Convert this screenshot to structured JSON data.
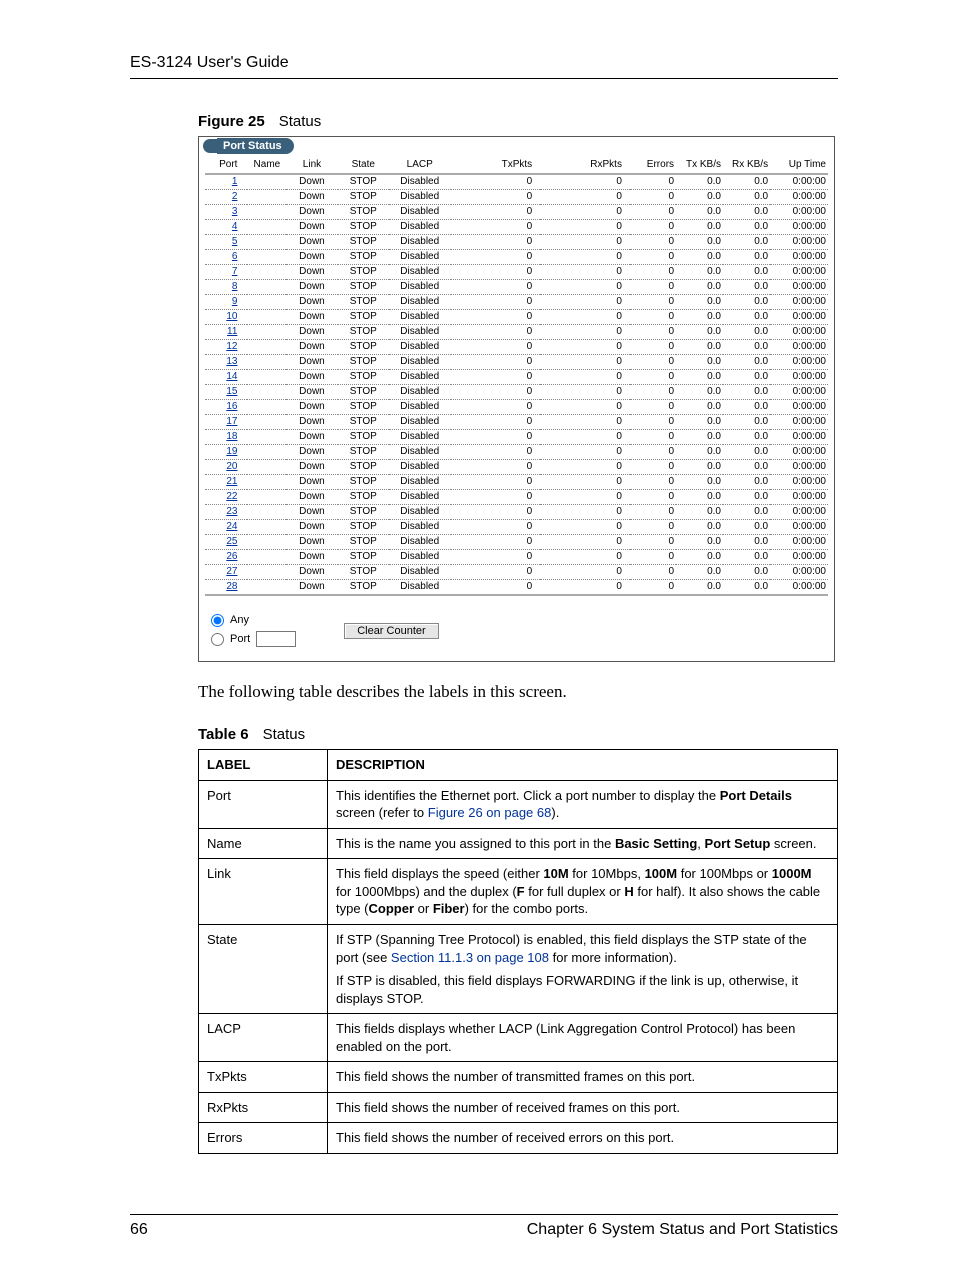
{
  "header": {
    "guide_title": "ES-3124 User's Guide"
  },
  "figure": {
    "label": "Figure 25",
    "title": "Status"
  },
  "panel": {
    "tab_title": "Port Status",
    "columns": {
      "port": "Port",
      "name": "Name",
      "link": "Link",
      "state": "State",
      "lacp": "LACP",
      "txpkts": "TxPkts",
      "rxpkts": "RxPkts",
      "errors": "Errors",
      "txkbs": "Tx KB/s",
      "rxkbs": "Rx KB/s",
      "uptime": "Up Time"
    },
    "rows": [
      {
        "port": "1",
        "name": "",
        "link": "Down",
        "state": "STOP",
        "lacp": "Disabled",
        "tx": "0",
        "rx": "0",
        "err": "0",
        "txk": "0.0",
        "rxk": "0.0",
        "ut": "0:00:00"
      },
      {
        "port": "2",
        "name": "",
        "link": "Down",
        "state": "STOP",
        "lacp": "Disabled",
        "tx": "0",
        "rx": "0",
        "err": "0",
        "txk": "0.0",
        "rxk": "0.0",
        "ut": "0:00:00"
      },
      {
        "port": "3",
        "name": "",
        "link": "Down",
        "state": "STOP",
        "lacp": "Disabled",
        "tx": "0",
        "rx": "0",
        "err": "0",
        "txk": "0.0",
        "rxk": "0.0",
        "ut": "0:00:00"
      },
      {
        "port": "4",
        "name": "",
        "link": "Down",
        "state": "STOP",
        "lacp": "Disabled",
        "tx": "0",
        "rx": "0",
        "err": "0",
        "txk": "0.0",
        "rxk": "0.0",
        "ut": "0:00:00"
      },
      {
        "port": "5",
        "name": "",
        "link": "Down",
        "state": "STOP",
        "lacp": "Disabled",
        "tx": "0",
        "rx": "0",
        "err": "0",
        "txk": "0.0",
        "rxk": "0.0",
        "ut": "0:00:00"
      },
      {
        "port": "6",
        "name": "",
        "link": "Down",
        "state": "STOP",
        "lacp": "Disabled",
        "tx": "0",
        "rx": "0",
        "err": "0",
        "txk": "0.0",
        "rxk": "0.0",
        "ut": "0:00:00"
      },
      {
        "port": "7",
        "name": "",
        "link": "Down",
        "state": "STOP",
        "lacp": "Disabled",
        "tx": "0",
        "rx": "0",
        "err": "0",
        "txk": "0.0",
        "rxk": "0.0",
        "ut": "0:00:00"
      },
      {
        "port": "8",
        "name": "",
        "link": "Down",
        "state": "STOP",
        "lacp": "Disabled",
        "tx": "0",
        "rx": "0",
        "err": "0",
        "txk": "0.0",
        "rxk": "0.0",
        "ut": "0:00:00"
      },
      {
        "port": "9",
        "name": "",
        "link": "Down",
        "state": "STOP",
        "lacp": "Disabled",
        "tx": "0",
        "rx": "0",
        "err": "0",
        "txk": "0.0",
        "rxk": "0.0",
        "ut": "0:00:00"
      },
      {
        "port": "10",
        "name": "",
        "link": "Down",
        "state": "STOP",
        "lacp": "Disabled",
        "tx": "0",
        "rx": "0",
        "err": "0",
        "txk": "0.0",
        "rxk": "0.0",
        "ut": "0:00:00"
      },
      {
        "port": "11",
        "name": "",
        "link": "Down",
        "state": "STOP",
        "lacp": "Disabled",
        "tx": "0",
        "rx": "0",
        "err": "0",
        "txk": "0.0",
        "rxk": "0.0",
        "ut": "0:00:00"
      },
      {
        "port": "12",
        "name": "",
        "link": "Down",
        "state": "STOP",
        "lacp": "Disabled",
        "tx": "0",
        "rx": "0",
        "err": "0",
        "txk": "0.0",
        "rxk": "0.0",
        "ut": "0:00:00"
      },
      {
        "port": "13",
        "name": "",
        "link": "Down",
        "state": "STOP",
        "lacp": "Disabled",
        "tx": "0",
        "rx": "0",
        "err": "0",
        "txk": "0.0",
        "rxk": "0.0",
        "ut": "0:00:00"
      },
      {
        "port": "14",
        "name": "",
        "link": "Down",
        "state": "STOP",
        "lacp": "Disabled",
        "tx": "0",
        "rx": "0",
        "err": "0",
        "txk": "0.0",
        "rxk": "0.0",
        "ut": "0:00:00"
      },
      {
        "port": "15",
        "name": "",
        "link": "Down",
        "state": "STOP",
        "lacp": "Disabled",
        "tx": "0",
        "rx": "0",
        "err": "0",
        "txk": "0.0",
        "rxk": "0.0",
        "ut": "0:00:00"
      },
      {
        "port": "16",
        "name": "",
        "link": "Down",
        "state": "STOP",
        "lacp": "Disabled",
        "tx": "0",
        "rx": "0",
        "err": "0",
        "txk": "0.0",
        "rxk": "0.0",
        "ut": "0:00:00"
      },
      {
        "port": "17",
        "name": "",
        "link": "Down",
        "state": "STOP",
        "lacp": "Disabled",
        "tx": "0",
        "rx": "0",
        "err": "0",
        "txk": "0.0",
        "rxk": "0.0",
        "ut": "0:00:00"
      },
      {
        "port": "18",
        "name": "",
        "link": "Down",
        "state": "STOP",
        "lacp": "Disabled",
        "tx": "0",
        "rx": "0",
        "err": "0",
        "txk": "0.0",
        "rxk": "0.0",
        "ut": "0:00:00"
      },
      {
        "port": "19",
        "name": "",
        "link": "Down",
        "state": "STOP",
        "lacp": "Disabled",
        "tx": "0",
        "rx": "0",
        "err": "0",
        "txk": "0.0",
        "rxk": "0.0",
        "ut": "0:00:00"
      },
      {
        "port": "20",
        "name": "",
        "link": "Down",
        "state": "STOP",
        "lacp": "Disabled",
        "tx": "0",
        "rx": "0",
        "err": "0",
        "txk": "0.0",
        "rxk": "0.0",
        "ut": "0:00:00"
      },
      {
        "port": "21",
        "name": "",
        "link": "Down",
        "state": "STOP",
        "lacp": "Disabled",
        "tx": "0",
        "rx": "0",
        "err": "0",
        "txk": "0.0",
        "rxk": "0.0",
        "ut": "0:00:00"
      },
      {
        "port": "22",
        "name": "",
        "link": "Down",
        "state": "STOP",
        "lacp": "Disabled",
        "tx": "0",
        "rx": "0",
        "err": "0",
        "txk": "0.0",
        "rxk": "0.0",
        "ut": "0:00:00"
      },
      {
        "port": "23",
        "name": "",
        "link": "Down",
        "state": "STOP",
        "lacp": "Disabled",
        "tx": "0",
        "rx": "0",
        "err": "0",
        "txk": "0.0",
        "rxk": "0.0",
        "ut": "0:00:00"
      },
      {
        "port": "24",
        "name": "",
        "link": "Down",
        "state": "STOP",
        "lacp": "Disabled",
        "tx": "0",
        "rx": "0",
        "err": "0",
        "txk": "0.0",
        "rxk": "0.0",
        "ut": "0:00:00"
      },
      {
        "port": "25",
        "name": "",
        "link": "Down",
        "state": "STOP",
        "lacp": "Disabled",
        "tx": "0",
        "rx": "0",
        "err": "0",
        "txk": "0.0",
        "rxk": "0.0",
        "ut": "0:00:00"
      },
      {
        "port": "26",
        "name": "",
        "link": "Down",
        "state": "STOP",
        "lacp": "Disabled",
        "tx": "0",
        "rx": "0",
        "err": "0",
        "txk": "0.0",
        "rxk": "0.0",
        "ut": "0:00:00"
      },
      {
        "port": "27",
        "name": "",
        "link": "Down",
        "state": "STOP",
        "lacp": "Disabled",
        "tx": "0",
        "rx": "0",
        "err": "0",
        "txk": "0.0",
        "rxk": "0.0",
        "ut": "0:00:00"
      },
      {
        "port": "28",
        "name": "",
        "link": "Down",
        "state": "STOP",
        "lacp": "Disabled",
        "tx": "0",
        "rx": "0",
        "err": "0",
        "txk": "0.0",
        "rxk": "0.0",
        "ut": "0:00:00"
      }
    ],
    "footer": {
      "any_label": "Any",
      "port_label": "Port",
      "clear_label": "Clear Counter",
      "port_value": ""
    }
  },
  "body_text": "The following table describes the labels in this screen.",
  "table_caption": {
    "label": "Table 6",
    "title": "Status"
  },
  "desc_table": {
    "head_label": "LABEL",
    "head_desc": "DESCRIPTION",
    "rows": [
      {
        "label": "Port",
        "desc_pre": "This identifies the Ethernet port. Click a port number to display the ",
        "bold1": "Port Details",
        "mid1": " screen (refer to ",
        "xref": "Figure 26 on page 68",
        "post": ")."
      },
      {
        "label": "Name",
        "desc_pre": "This is the name you assigned to this port in the ",
        "bold1": "Basic Setting",
        "mid1": ", ",
        "bold2": "Port Setup",
        "post": " screen."
      },
      {
        "label": "Link",
        "desc_pre": "This field displays the speed (either ",
        "bold1": "10M",
        "mid1": " for 10Mbps, ",
        "bold2": "100M",
        "mid2": " for 100Mbps or ",
        "bold3": "1000M",
        "mid3": " for 1000Mbps) and the duplex (",
        "bold4": "F",
        "mid4": " for full duplex or ",
        "bold5": "H",
        "mid5": " for half). It also shows the cable type (",
        "bold6": "Copper",
        "mid6": " or ",
        "bold7": "Fiber",
        "post": ") for the combo ports."
      },
      {
        "label": "State",
        "para1_pre": "If STP (Spanning Tree Protocol) is enabled, this field displays the STP state of the port (see ",
        "xref": "Section 11.1.3 on page 108",
        "para1_post": " for more information).",
        "para2": "If STP is disabled, this field displays FORWARDING if the link is up, otherwise, it displays STOP."
      },
      {
        "label": "LACP",
        "plain": "This fields displays whether LACP (Link Aggregation Control Protocol) has been enabled on the port."
      },
      {
        "label": "TxPkts",
        "plain": "This field shows the number of transmitted frames on this port."
      },
      {
        "label": "RxPkts",
        "plain": "This field shows the number of received frames on this port."
      },
      {
        "label": "Errors",
        "plain": "This field shows the number of received errors on this port."
      }
    ]
  },
  "footer": {
    "page_no": "66",
    "chapter": "Chapter 6 System Status and Port Statistics"
  }
}
